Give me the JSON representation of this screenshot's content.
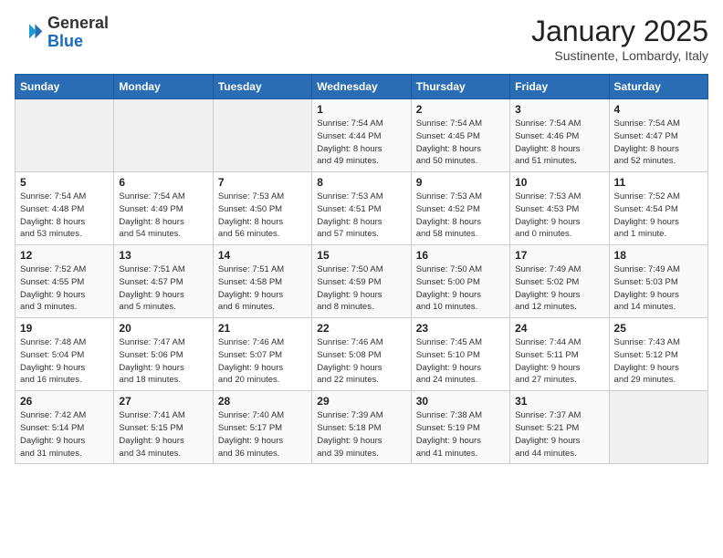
{
  "logo": {
    "general": "General",
    "blue": "Blue"
  },
  "header": {
    "title": "January 2025",
    "subtitle": "Sustinente, Lombardy, Italy"
  },
  "days_of_week": [
    "Sunday",
    "Monday",
    "Tuesday",
    "Wednesday",
    "Thursday",
    "Friday",
    "Saturday"
  ],
  "weeks": [
    [
      {
        "day": "",
        "info": ""
      },
      {
        "day": "",
        "info": ""
      },
      {
        "day": "",
        "info": ""
      },
      {
        "day": "1",
        "info": "Sunrise: 7:54 AM\nSunset: 4:44 PM\nDaylight: 8 hours\nand 49 minutes."
      },
      {
        "day": "2",
        "info": "Sunrise: 7:54 AM\nSunset: 4:45 PM\nDaylight: 8 hours\nand 50 minutes."
      },
      {
        "day": "3",
        "info": "Sunrise: 7:54 AM\nSunset: 4:46 PM\nDaylight: 8 hours\nand 51 minutes."
      },
      {
        "day": "4",
        "info": "Sunrise: 7:54 AM\nSunset: 4:47 PM\nDaylight: 8 hours\nand 52 minutes."
      }
    ],
    [
      {
        "day": "5",
        "info": "Sunrise: 7:54 AM\nSunset: 4:48 PM\nDaylight: 8 hours\nand 53 minutes."
      },
      {
        "day": "6",
        "info": "Sunrise: 7:54 AM\nSunset: 4:49 PM\nDaylight: 8 hours\nand 54 minutes."
      },
      {
        "day": "7",
        "info": "Sunrise: 7:53 AM\nSunset: 4:50 PM\nDaylight: 8 hours\nand 56 minutes."
      },
      {
        "day": "8",
        "info": "Sunrise: 7:53 AM\nSunset: 4:51 PM\nDaylight: 8 hours\nand 57 minutes."
      },
      {
        "day": "9",
        "info": "Sunrise: 7:53 AM\nSunset: 4:52 PM\nDaylight: 8 hours\nand 58 minutes."
      },
      {
        "day": "10",
        "info": "Sunrise: 7:53 AM\nSunset: 4:53 PM\nDaylight: 9 hours\nand 0 minutes."
      },
      {
        "day": "11",
        "info": "Sunrise: 7:52 AM\nSunset: 4:54 PM\nDaylight: 9 hours\nand 1 minute."
      }
    ],
    [
      {
        "day": "12",
        "info": "Sunrise: 7:52 AM\nSunset: 4:55 PM\nDaylight: 9 hours\nand 3 minutes."
      },
      {
        "day": "13",
        "info": "Sunrise: 7:51 AM\nSunset: 4:57 PM\nDaylight: 9 hours\nand 5 minutes."
      },
      {
        "day": "14",
        "info": "Sunrise: 7:51 AM\nSunset: 4:58 PM\nDaylight: 9 hours\nand 6 minutes."
      },
      {
        "day": "15",
        "info": "Sunrise: 7:50 AM\nSunset: 4:59 PM\nDaylight: 9 hours\nand 8 minutes."
      },
      {
        "day": "16",
        "info": "Sunrise: 7:50 AM\nSunset: 5:00 PM\nDaylight: 9 hours\nand 10 minutes."
      },
      {
        "day": "17",
        "info": "Sunrise: 7:49 AM\nSunset: 5:02 PM\nDaylight: 9 hours\nand 12 minutes."
      },
      {
        "day": "18",
        "info": "Sunrise: 7:49 AM\nSunset: 5:03 PM\nDaylight: 9 hours\nand 14 minutes."
      }
    ],
    [
      {
        "day": "19",
        "info": "Sunrise: 7:48 AM\nSunset: 5:04 PM\nDaylight: 9 hours\nand 16 minutes."
      },
      {
        "day": "20",
        "info": "Sunrise: 7:47 AM\nSunset: 5:06 PM\nDaylight: 9 hours\nand 18 minutes."
      },
      {
        "day": "21",
        "info": "Sunrise: 7:46 AM\nSunset: 5:07 PM\nDaylight: 9 hours\nand 20 minutes."
      },
      {
        "day": "22",
        "info": "Sunrise: 7:46 AM\nSunset: 5:08 PM\nDaylight: 9 hours\nand 22 minutes."
      },
      {
        "day": "23",
        "info": "Sunrise: 7:45 AM\nSunset: 5:10 PM\nDaylight: 9 hours\nand 24 minutes."
      },
      {
        "day": "24",
        "info": "Sunrise: 7:44 AM\nSunset: 5:11 PM\nDaylight: 9 hours\nand 27 minutes."
      },
      {
        "day": "25",
        "info": "Sunrise: 7:43 AM\nSunset: 5:12 PM\nDaylight: 9 hours\nand 29 minutes."
      }
    ],
    [
      {
        "day": "26",
        "info": "Sunrise: 7:42 AM\nSunset: 5:14 PM\nDaylight: 9 hours\nand 31 minutes."
      },
      {
        "day": "27",
        "info": "Sunrise: 7:41 AM\nSunset: 5:15 PM\nDaylight: 9 hours\nand 34 minutes."
      },
      {
        "day": "28",
        "info": "Sunrise: 7:40 AM\nSunset: 5:17 PM\nDaylight: 9 hours\nand 36 minutes."
      },
      {
        "day": "29",
        "info": "Sunrise: 7:39 AM\nSunset: 5:18 PM\nDaylight: 9 hours\nand 39 minutes."
      },
      {
        "day": "30",
        "info": "Sunrise: 7:38 AM\nSunset: 5:19 PM\nDaylight: 9 hours\nand 41 minutes."
      },
      {
        "day": "31",
        "info": "Sunrise: 7:37 AM\nSunset: 5:21 PM\nDaylight: 9 hours\nand 44 minutes."
      },
      {
        "day": "",
        "info": ""
      }
    ]
  ]
}
